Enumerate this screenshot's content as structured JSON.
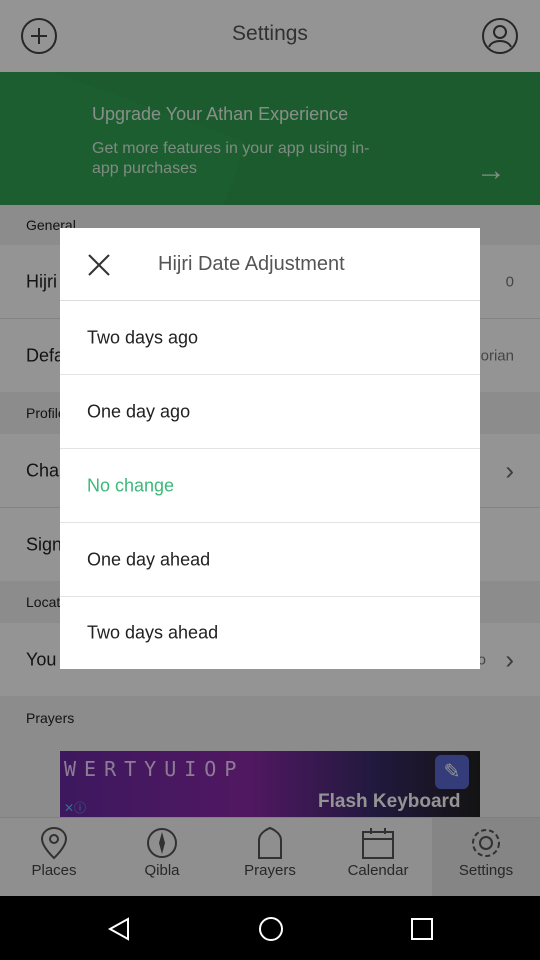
{
  "topbar": {
    "title": "Settings",
    "add_icon": "plus-circle-icon",
    "profile_icon": "user-circle-icon"
  },
  "banner": {
    "title": "Upgrade Your Athan Experience",
    "subtitle": "Get more features in your app using in-app purchases",
    "arrow": "→"
  },
  "settings": {
    "sections": [
      "General",
      "Profile",
      "Location",
      "Prayers"
    ],
    "rows": [
      {
        "label": "Hijri",
        "value": "0"
      },
      {
        "label": "Default",
        "value": "orian"
      },
      {
        "label": "Cha",
        "value": ""
      },
      {
        "label": "Sign",
        "value": ""
      },
      {
        "label": "You",
        "value": "o"
      }
    ]
  },
  "ad": {
    "keys": "WERTYUIOP",
    "label": "Flash Keyboard"
  },
  "tabs": [
    {
      "label": "Places",
      "icon": "map-pin-icon"
    },
    {
      "label": "Qibla",
      "icon": "compass-icon"
    },
    {
      "label": "Prayers",
      "icon": "mosque-door-icon"
    },
    {
      "label": "Calendar",
      "icon": "calendar-icon"
    },
    {
      "label": "Settings",
      "icon": "gear-icon",
      "active": true
    }
  ],
  "dialog": {
    "title": "Hijri Date Adjustment",
    "options": [
      "Two days ago",
      "One day ago",
      "No change",
      "One day ahead",
      "Two days ahead"
    ],
    "selected": "No change",
    "accent": "#3cb879"
  },
  "colors": {
    "banner": "#2f9e4e",
    "accent": "#3cb879"
  }
}
